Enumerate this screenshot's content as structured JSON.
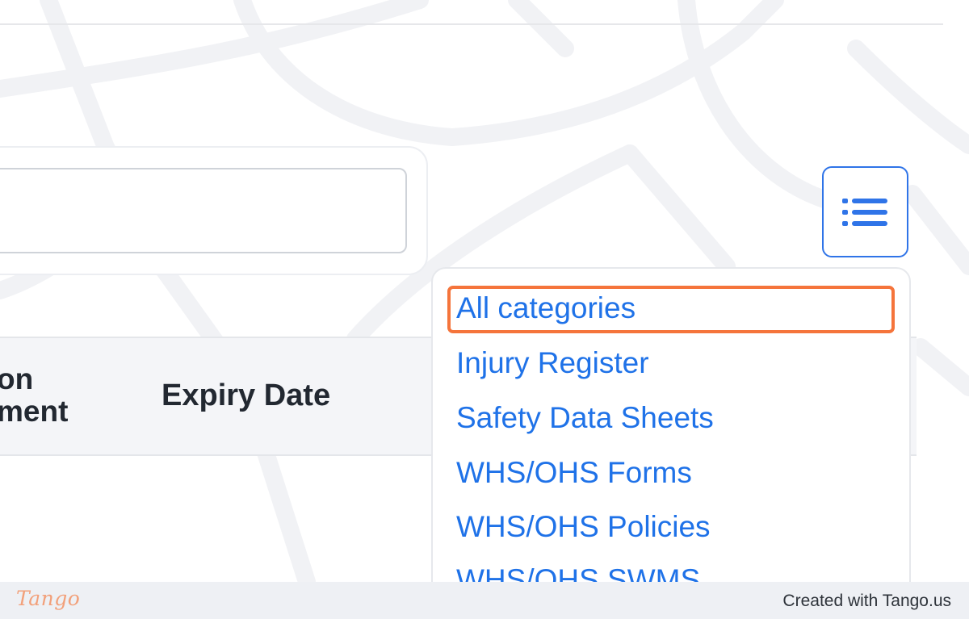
{
  "table": {
    "partial_column_line1": "on",
    "partial_column_line2": "ment",
    "expiry_header": "Expiry Date"
  },
  "filter_button": {
    "icon": "list-icon"
  },
  "dropdown": {
    "items": [
      {
        "label": "All categories",
        "highlighted": true
      },
      {
        "label": "Injury Register"
      },
      {
        "label": "Safety Data Sheets"
      },
      {
        "label": "WHS/OHS Forms"
      },
      {
        "label": "WHS/OHS Policies"
      },
      {
        "label": "WHS/OHS SWMS"
      }
    ]
  },
  "footer": {
    "logo": "Tango",
    "credit": "Created with Tango.us"
  },
  "colors": {
    "accent": "#1f72e8",
    "highlight": "#f5743b",
    "header_bg": "#f4f5f8"
  }
}
